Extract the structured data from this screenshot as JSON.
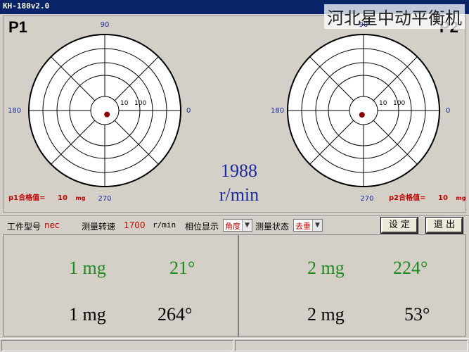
{
  "window": {
    "title": "KH-180v2.0"
  },
  "watermark": "河北星中动平衡机",
  "p1": {
    "label": "P1",
    "angles": {
      "a90": "90",
      "a180": "180",
      "a0": "0",
      "a270": "270"
    },
    "rings": {
      "r10": "10",
      "r100": "100"
    },
    "qualified_label": "p1合格值=",
    "qualified_value": "10",
    "qualified_unit": "mg",
    "point": {
      "angle_deg": 300,
      "radius_fraction": 0.06
    }
  },
  "p2": {
    "label": "P2",
    "angles": {
      "a90": "90",
      "a180": "180",
      "a0": "0",
      "a270": "270"
    },
    "rings": {
      "r10": "10",
      "r100": "100"
    },
    "qualified_label": "p2合格值=",
    "qualified_value": "10",
    "qualified_unit": "mg",
    "point": {
      "angle_deg": 250,
      "radius_fraction": 0.06
    }
  },
  "speed": {
    "value": "1988",
    "unit": "r/min"
  },
  "toolbar": {
    "workpiece_label": "工件型号",
    "workpiece_value": "nec",
    "measure_speed_label": "测量转速",
    "measure_speed_value": "1700",
    "measure_speed_unit": "r/min",
    "phase_label": "相位显示",
    "phase_value": "角度",
    "state_label": "测量状态",
    "state_value": "去重",
    "settings_button": "设 定",
    "exit_button": "退 出"
  },
  "results": {
    "left": {
      "green_mass": "1 mg",
      "green_angle": "21°",
      "black_mass": "1 mg",
      "black_angle": "264°"
    },
    "right": {
      "green_mass": "2 mg",
      "green_angle": "224°",
      "black_mass": "2 mg",
      "black_angle": "53°"
    }
  },
  "colors": {
    "accent_blue": "#1a2a9c",
    "result_green": "#1e8a1e",
    "qualified_red": "#c00000",
    "point_red": "#8b0000"
  }
}
